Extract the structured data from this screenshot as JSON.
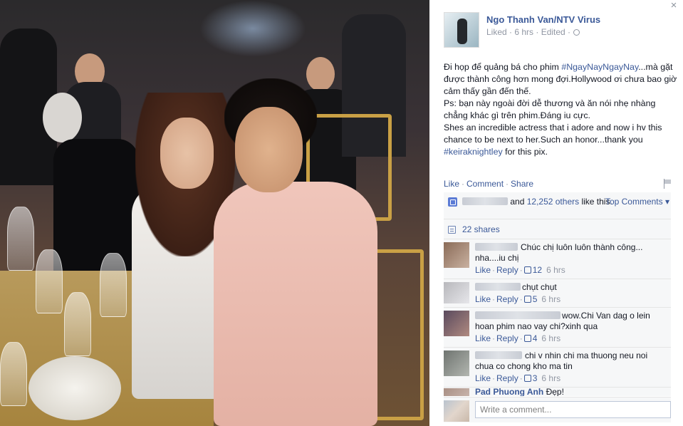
{
  "photo": {
    "alt": ""
  },
  "header": {
    "author": "Ngo Thanh Van/NTV Virus",
    "meta": "Liked · 6 hrs · Edited ·",
    "close_icon": "×"
  },
  "post": {
    "p1_pre": "Đi họp để quảng bá cho phim ",
    "p1_tag": "#NgayNayNgayNay",
    "p1_post": "...mà gặt được thành công hơn mong đợi.Hollywood ơi chưa bao giờ cảm thấy gần đến thế.",
    "p2": "Ps: bạn này ngoài đời dễ thương và ăn nói nhẹ nhàng chẳng khác gì trên phim.Đáng iu cực.",
    "p3_pre": "Shes an incredible actress that i adore and now i hv this chance to be next to her.Such an honor...thank you ",
    "p3_tag": "#keiraknightley",
    "p3_post": " for this pix."
  },
  "actions": {
    "like": "Like",
    "comment": "Comment",
    "share": "Share",
    "sep": "·"
  },
  "ufi": {
    "likes_and": "and",
    "likes_others": "12,252 others",
    "likes_suffix": " like this.",
    "top_comments": "Top Comments ▾",
    "shares": "22 shares"
  },
  "comments": [
    {
      "name_hidden": true,
      "text": "Chúc chị luôn luôn thành công... nha....iu chị",
      "like": "Like",
      "reply": "Reply",
      "count": "12",
      "time": "6 hrs",
      "avatar_colors": [
        "#8a6b58",
        "#c9b1a0"
      ]
    },
    {
      "name_hidden": true,
      "text": "chụt chụt",
      "like": "Like",
      "reply": "Reply",
      "count": "5",
      "time": "6 hrs",
      "avatar_colors": [
        "#b8b8bc",
        "#e6e6ea"
      ]
    },
    {
      "name_hidden": true,
      "text": "wow.Chi Van dag o lein hoan phim nao vay chi?xinh qua",
      "like": "Like",
      "reply": "Reply",
      "count": "4",
      "time": "6 hrs",
      "avatar_colors": [
        "#5a4a5e",
        "#b08a80"
      ]
    },
    {
      "name_hidden": true,
      "text": "chi v nhin chi ma thuong neu noi chua co chong kho ma tin",
      "like": "Like",
      "reply": "Reply",
      "count": "3",
      "time": "6 hrs",
      "avatar_colors": [
        "#6f7470",
        "#b2b6b0"
      ]
    },
    {
      "name": "Pad Phuong Anh",
      "text": "Đẹp!",
      "avatar_colors": [
        "#a98f84",
        "#d8c7c0"
      ]
    }
  ],
  "write": {
    "placeholder": "Write a comment..."
  },
  "colors": {
    "link": "#3b5998",
    "meta": "#9197a3",
    "ufi_bg": "#f6f7f8"
  }
}
